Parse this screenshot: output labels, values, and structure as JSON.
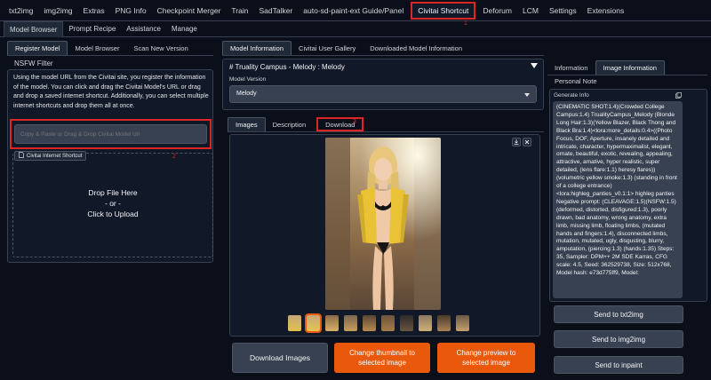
{
  "top_tabs": [
    {
      "label": "txt2img"
    },
    {
      "label": "img2img"
    },
    {
      "label": "Extras"
    },
    {
      "label": "PNG Info"
    },
    {
      "label": "Checkpoint Merger"
    },
    {
      "label": "Train"
    },
    {
      "label": "SadTalker"
    },
    {
      "label": "auto-sd-paint-ext Guide/Panel"
    },
    {
      "label": "Civitai Shortcut"
    },
    {
      "label": "Deforum"
    },
    {
      "label": "LCM"
    },
    {
      "label": "Settings"
    },
    {
      "label": "Extensions"
    }
  ],
  "annotations": {
    "one": "1",
    "two": "2",
    "three": "3"
  },
  "sub_tabs": [
    {
      "label": "Model Browser"
    },
    {
      "label": "Prompt Recipe"
    },
    {
      "label": "Assistance"
    },
    {
      "label": "Manage"
    }
  ],
  "left": {
    "tabs": [
      {
        "label": "Register Model"
      },
      {
        "label": "Model Browser"
      },
      {
        "label": "Scan New Version"
      }
    ],
    "nsfw_filter": "NSFW Filter",
    "description": "Using the model URL from the Civitai site, you register the information of the model. You can click and drag the Civitai Model's URL or drag and drop a saved internet shortcut. Additionally, you can select multiple internet shortcuts and drop them all at once.",
    "url_placeholder": "Copy & Paste or Drag & Drop Civitai Model Url",
    "shortcut_label": "Civitai Internet Shortcut",
    "drop_line1": "Drop File Here",
    "drop_line2": "- or -",
    "drop_line3": "Click to Upload"
  },
  "center": {
    "tabs": [
      {
        "label": "Model Information"
      },
      {
        "label": "Civitai User Gallery"
      },
      {
        "label": "Downloaded Model Information"
      }
    ],
    "model_select": "# Truality Campus - Melody : Melody",
    "model_version_label": "Model Version",
    "model_version_value": "Melody",
    "image_tabs": [
      {
        "label": "Images"
      },
      {
        "label": "Description"
      },
      {
        "label": "Download"
      }
    ],
    "download_image_button": "Download Images",
    "change_thumbnail_button": "Change thumbnail to selected image",
    "change_preview_button": "Change preview to selected image"
  },
  "right": {
    "tabs": [
      {
        "label": "Information"
      },
      {
        "label": "Image Information"
      }
    ],
    "personal_note": "Personal Note",
    "generate_info_label": "Generate Info",
    "generate_info_text": "(CINEMATIC SHOT:1.4)(Crowded College Campus:1.4) TrualityCampus_Melody (Blonde Long Hair:1.3)(Yellow Blazer, Black Thong and Black Bra:1.4)<lora:more_details:0.4>((Photo Focus, DOF, Aperture, insanely detailed and intricate, character, hypermaximalist, elegant, ornate, beautiful, exotic, revealing, appealing, attractive, amative, hyper realistic, super detailed, (lens flare:1.1) heresy flares)) (volumetric yellow smoke:1.3) (standing in front of a college entrance) <lora:highleg_panties_v0.1:1> highleg panties Negative prompt: (CLEAVAGE:1.5)(NSFW:1.5) (deformed, distorted, disfigured:1.3), poorly drawn, bad anatomy, wrong anatomy, extra limb, missing limb, floating limbs, (mutated hands and fingers:1.4), disconnected limbs, mutation, mutated, ugly, disgusting, blurry, amputation, (piercing:1.3) (hands:1.35) Steps: 35, Sampler: DPM++ 2M SDE Karras, CFG scale: 4.5, Seed: 362529738, Size: 512x768, Model hash: e73d775ff9, Model:",
    "send_txt2img": "Send to txt2img",
    "send_img2img": "Send to img2img",
    "send_inpaint": "Send to inpaint"
  },
  "colors": {
    "accent": "#ea580c",
    "highlight": "#dc2626",
    "background": "#0b0f19"
  },
  "icons": [
    "dropdown-arrow-icon",
    "chevron-down-icon",
    "download-icon",
    "close-icon",
    "copy-icon",
    "file-icon"
  ]
}
